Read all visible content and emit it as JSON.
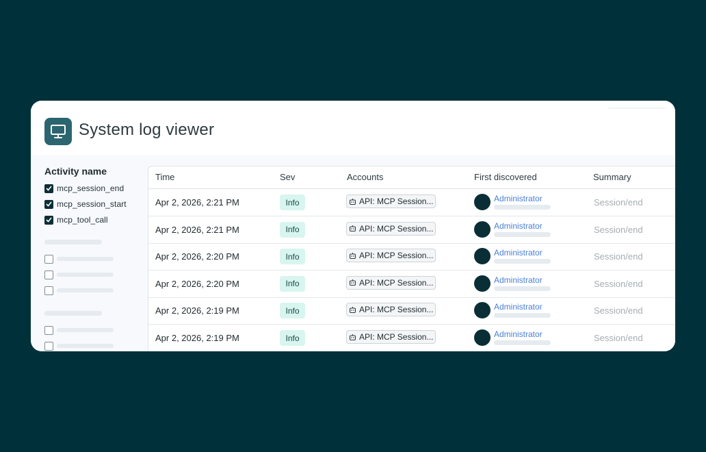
{
  "header": {
    "title": "System log viewer",
    "icon": "monitor-icon"
  },
  "sidebar": {
    "filter_title": "Activity name",
    "filters": [
      {
        "label": "mcp_session_end",
        "checked": true
      },
      {
        "label": "mcp_session_start",
        "checked": true
      },
      {
        "label": "mcp_tool_call",
        "checked": true
      }
    ]
  },
  "table": {
    "columns": [
      "Time",
      "Sev",
      "Accounts",
      "First discovered",
      "Summary"
    ],
    "rows": [
      {
        "time": "Apr 2, 2026, 2:21 PM",
        "sev": "Info",
        "account": "API: MCP Session...",
        "first_discovered": "Administrator",
        "summary": "Session/end"
      },
      {
        "time": "Apr 2, 2026, 2:21 PM",
        "sev": "Info",
        "account": "API: MCP Session...",
        "first_discovered": "Administrator",
        "summary": "Session/end"
      },
      {
        "time": "Apr 2, 2026, 2:20 PM",
        "sev": "Info",
        "account": "API: MCP Session...",
        "first_discovered": "Administrator",
        "summary": "Session/end"
      },
      {
        "time": "Apr 2, 2026, 2:20 PM",
        "sev": "Info",
        "account": "API: MCP Session...",
        "first_discovered": "Administrator",
        "summary": "Session/end"
      },
      {
        "time": "Apr 2, 2026, 2:19 PM",
        "sev": "Info",
        "account": "API: MCP Session...",
        "first_discovered": "Administrator",
        "summary": "Session/end"
      },
      {
        "time": "Apr 2, 2026, 2:19 PM",
        "sev": "Info",
        "account": "API: MCP Session...",
        "first_discovered": "Administrator",
        "summary": "Session/end"
      }
    ]
  },
  "colors": {
    "background": "#00303a",
    "icon_tile": "#2b6570",
    "sev_badge": "#d8f5ef",
    "link": "#4a7fd4",
    "avatar": "#0a2e36"
  }
}
